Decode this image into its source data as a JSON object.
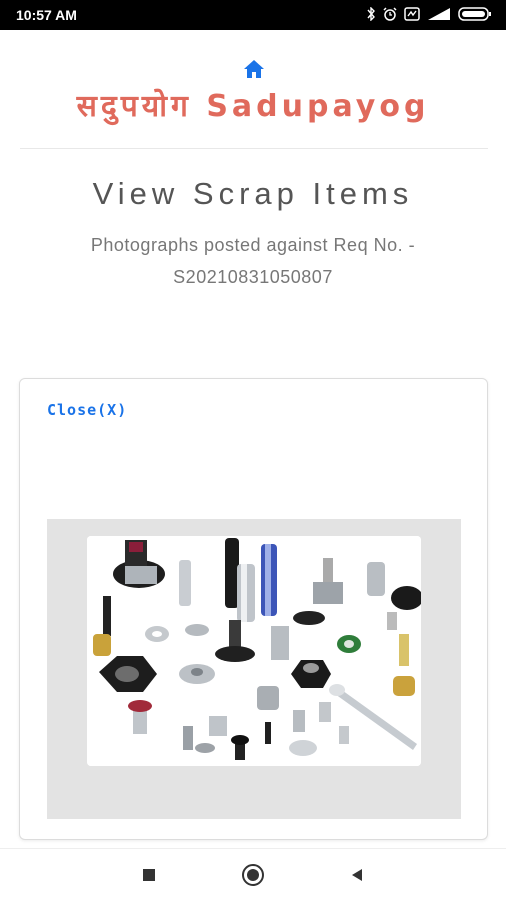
{
  "status_bar": {
    "time": "10:57 AM",
    "icons": [
      "bluetooth-icon",
      "alarm-icon",
      "data-saver-icon",
      "signal-icon",
      "battery-icon"
    ]
  },
  "header": {
    "home_icon": "home-icon",
    "brand": "सदुपयोग Sadupayog",
    "brand_color": "#e06a5c",
    "accent_color": "#1a73e8"
  },
  "main": {
    "title": "View Scrap Items",
    "subtitle": "Photographs posted against Req No. - S20210831050807"
  },
  "card": {
    "close_label": "Close(X)",
    "photo_icon": "hardware-fasteners-photo"
  },
  "nav": {
    "recents_icon": "recents-square-icon",
    "home_icon": "home-circle-icon",
    "back_icon": "back-triangle-icon"
  }
}
